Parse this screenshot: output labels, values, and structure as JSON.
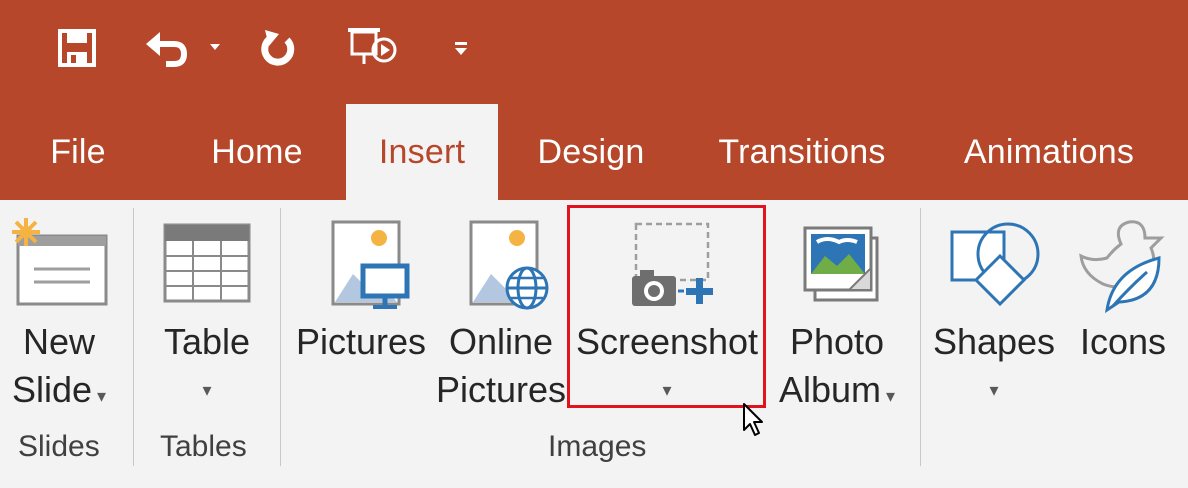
{
  "app": {
    "accent_color": "#b7472a",
    "ribbon_bg": "#f3f3f3"
  },
  "quick_access": [
    {
      "name": "save-icon"
    },
    {
      "name": "undo-icon"
    },
    {
      "name": "redo-icon"
    },
    {
      "name": "start-slideshow-icon"
    },
    {
      "name": "customize-qat-icon"
    }
  ],
  "tabs": [
    {
      "label": "File"
    },
    {
      "label": "Home"
    },
    {
      "label": "Insert",
      "active": true
    },
    {
      "label": "Design"
    },
    {
      "label": "Transitions"
    },
    {
      "label": "Animations"
    }
  ],
  "ribbon": {
    "new_slide": {
      "line1": "New",
      "line2": "Slide"
    },
    "table": {
      "label": "Table"
    },
    "pictures": {
      "label": "Pictures"
    },
    "online_pictures": {
      "line1": "Online",
      "line2": "Pictures"
    },
    "screenshot": {
      "label": "Screenshot"
    },
    "photo_album": {
      "line1": "Photo",
      "line2": "Album"
    },
    "shapes": {
      "label": "Shapes"
    },
    "icons": {
      "label": "Icons"
    },
    "groups": {
      "slides": "Slides",
      "tables": "Tables",
      "images": "Images"
    }
  },
  "highlight_color": "#e0131e"
}
